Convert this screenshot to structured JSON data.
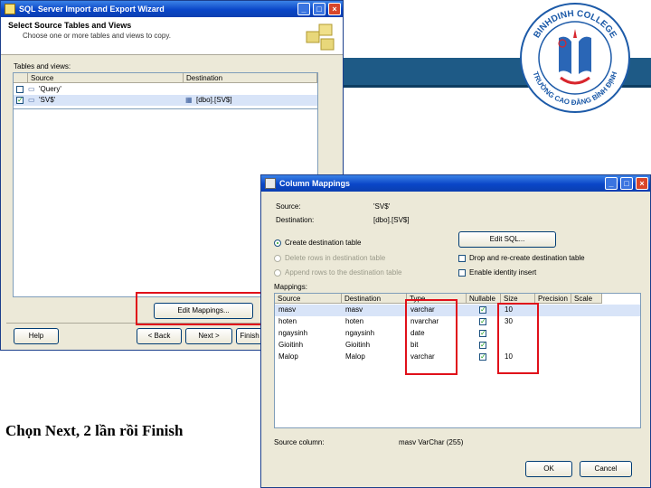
{
  "logo": {
    "top_text": "BINHDINH COLLEGE",
    "bottom_text": "TRƯỜNG CAO ĐẲNG BÌNH ĐỊNH"
  },
  "wizard": {
    "title": "SQL Server Import and Export Wizard",
    "header_title": "Select Source Tables and Views",
    "header_sub": "Choose one or more tables and views to copy.",
    "section_label": "Tables and views:",
    "col_source": "Source",
    "col_destination": "Destination",
    "rows": [
      {
        "source": "'Query'",
        "destination": ""
      },
      {
        "source": "'SV$'",
        "destination": "[dbo].[SV$]"
      }
    ],
    "edit_mappings": "Edit Mappings...",
    "help": "Help",
    "back": "< Back",
    "next": "Next >",
    "finish": "Finish"
  },
  "mappings": {
    "title": "Column Mappings",
    "source_label": "Source:",
    "source_value": "'SV$'",
    "destination_label": "Destination:",
    "destination_value": "[dbo].[SV$]",
    "opt_create": "Create destination table",
    "opt_delete": "Delete rows in destination table",
    "opt_append": "Append rows to the destination table",
    "edit_sql": "Edit SQL...",
    "drop_recreate": "Drop and re-create destination table",
    "identity_insert": "Enable identity insert",
    "mappings_label": "Mappings:",
    "headers": [
      "Source",
      "Destination",
      "Type",
      "Nullable",
      "Size",
      "Precision",
      "Scale"
    ],
    "rows": [
      {
        "source": "masv",
        "destination": "masv",
        "type": "varchar",
        "size": "10"
      },
      {
        "source": "hoten",
        "destination": "hoten",
        "type": "nvarchar",
        "size": "30"
      },
      {
        "source": "ngaysinh",
        "destination": "ngaysinh",
        "type": "date",
        "size": ""
      },
      {
        "source": "Gioitinh",
        "destination": "Gioitinh",
        "type": "bit",
        "size": ""
      },
      {
        "source": "Malop",
        "destination": "Malop",
        "type": "varchar",
        "size": "10"
      }
    ],
    "source_column_label": "Source column:",
    "source_column_value": "masv VarChar (255)",
    "ok": "OK",
    "cancel": "Cancel"
  },
  "caption": "Chọn Next, 2 lần rồi Finish"
}
